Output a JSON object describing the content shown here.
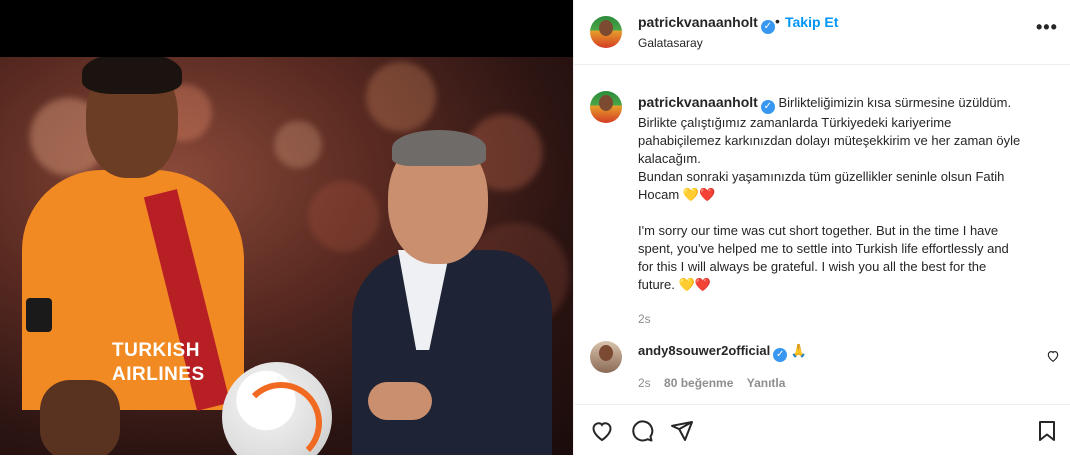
{
  "post": {
    "author": "patrickvanaanholt",
    "follow_label": "Takip Et",
    "dot": "•",
    "location": "Galatasaray",
    "more_label": "•••",
    "caption_lines": [
      "Birlikteliğimizin kısa sürmesine üzüldüm.",
      "Birlikte çalıştığımız zamanlarda Türkiyedeki kariyerime",
      "pahabiçilemez karkınızdan dolayı müteşekkirim ve her zaman öyle",
      "kalacağım.",
      "Bundan sonraki yaşamınızda tüm güzellikler seninle olsun Fatih",
      "Hocam 💛❤️",
      "",
      "I'm sorry our time was cut short together. But in the time I have",
      "spent, you've helped me to settle into Turkish life effortlessly and",
      "for this I will always be grateful. I wish you all the best for the",
      "future. 💛❤️"
    ],
    "caption_time": "2s"
  },
  "jersey": {
    "line1": "TURKISH",
    "line2": "AIRLINES"
  },
  "comment": {
    "user": "andy8souwer2official",
    "text": "🙏",
    "time": "2s",
    "likes": "80 beğenme",
    "reply": "Yanıtla"
  },
  "icons": {
    "verified": "✓"
  },
  "colors": {
    "accent_blue": "#0095f6",
    "verified_blue": "#3897f0",
    "meta_grey": "#8e8e8e"
  }
}
